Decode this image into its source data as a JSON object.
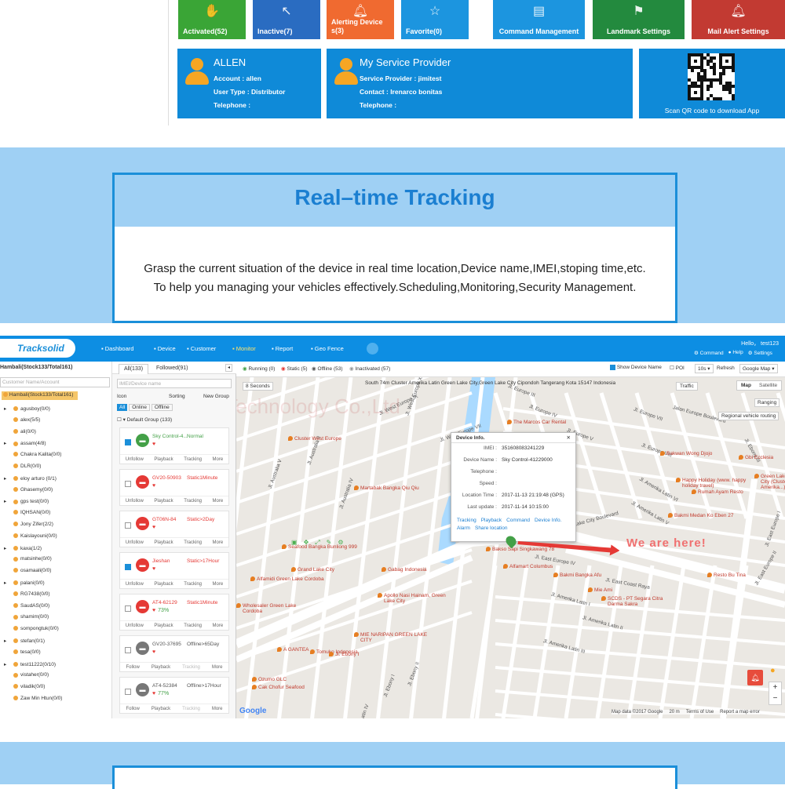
{
  "tiles": [
    {
      "label": "Activated(52)",
      "icon": "star-hand-icon",
      "color": "#3aa536"
    },
    {
      "label": "Inactive(7)",
      "icon": "cursor-click-icon",
      "color": "#2a6cc1"
    },
    {
      "label": "Alerting Device s(3)",
      "icon": "bell-icon",
      "color": "#f06a30"
    },
    {
      "label": "Favorite(0)",
      "icon": "star-icon",
      "color": "#1c95df"
    },
    {
      "label": "Command Management",
      "icon": "notebook-icon",
      "color": "#1c95df"
    },
    {
      "label": "Landmark Settings",
      "icon": "flag-icon",
      "color": "#238a3e"
    },
    {
      "label": "Mail Alert Settings",
      "icon": "bell-gear-icon",
      "color": "#c23a32"
    }
  ],
  "account_card": {
    "name": "ALLEN",
    "account": "Account : allen",
    "user_type": "User Type : Distributor",
    "telephone": "Telephone :"
  },
  "provider_card": {
    "name": "My Service Provider",
    "provider": "Service Provider : jimitest",
    "contact": "Contact : Irenarco bonitas",
    "telephone": "Telephone :"
  },
  "qr_card": {
    "caption": "Scan QR code to download App"
  },
  "banner": {
    "title": "Real–time Tracking",
    "line1": "Grasp the current situation of the device in real time location,Device name,IMEI,stoping time,etc.",
    "line2": "To help you managing your vehicles effectively.Scheduling,Monitoring,Security Management."
  },
  "app": {
    "logo": "Tracksolid",
    "nav": [
      "Dashboard",
      "Device",
      "Customer",
      "Monitor",
      "Report",
      "Geo Fence"
    ],
    "user": "Hello， test123",
    "cmd": "Command",
    "help": "Help",
    "settings": "Settings",
    "tree_title": "Hambali(Stock133/Total161)",
    "customer_placeholder": "Customer Name/Account",
    "tree_head": "Hambali(Stock133/Total161)",
    "tree": [
      "agusboy(0/0)",
      "alex(5/5)",
      "ali(0/0)",
      "assam(4/8)",
      "Chakra Kalita(0/0)",
      "DLR(0/0)",
      "eloy arturo (0/1)",
      "Ghasemy(0/0)",
      "gps test(0/0)",
      "IQHSAN(0/0)",
      "Jony Zifer(2/2)",
      "Kaislayouni(0/0)",
      "kaxa(1/2)",
      "matsinhe(0/0)",
      "osamaali(0/0)",
      "palani(0/0)",
      "RG7438(0/0)",
      "SaudAS(0/0)",
      "shamim(0/0)",
      "sompongtuk(0/0)",
      "stefan(0/1)",
      "tesa(0/0)",
      "test11222(0/10)",
      "vistaher(0/0)",
      "viladik(0/0)",
      "Zaw Min Htun(0/0)"
    ],
    "tab_all": "All(133)",
    "tab_followed": "Followed(91)",
    "imei_placeholder": "IMEI/Device name",
    "icon_label": "Icon",
    "sorting": "Sorting",
    "new_group": "New Group",
    "filter_all": "All",
    "filter_online": "Online",
    "filter_offline": "Offline",
    "default_group": "Default Group (133)",
    "devices": [
      {
        "name": "Sky Control-4...",
        "status": "Normal",
        "kind": "ok",
        "checked": true,
        "acts": [
          "Unfollow",
          "Playback",
          "Tracking",
          "More"
        ]
      },
      {
        "name": "GV20-50903",
        "status": "Static1Minute",
        "kind": "red",
        "checked": false,
        "acts": [
          "Unfollow",
          "Playback",
          "Tracking",
          "More"
        ]
      },
      {
        "name": "GT06N-84",
        "status": "Static>2Day",
        "kind": "red",
        "checked": false,
        "acts": [
          "Unfollow",
          "Playback",
          "Tracking",
          "More"
        ]
      },
      {
        "name": "Jieshan",
        "status": "Static>17Hour",
        "kind": "red",
        "checked": true,
        "acts": [
          "Unfollow",
          "Playback",
          "Tracking",
          "More"
        ]
      },
      {
        "name": "AT4-62129",
        "status": "Static1Minute",
        "kind": "red",
        "checked": false,
        "battery": "73%",
        "acts": [
          "Unfollow",
          "Playback",
          "Tracking",
          "More"
        ]
      },
      {
        "name": "GV20-37695",
        "status": "Offline>65Day",
        "kind": "gray",
        "checked": false,
        "acts": [
          "Follow",
          "Playback",
          "Tracking",
          "More"
        ]
      },
      {
        "name": "AT4-52384",
        "status": "Offline>17Hour",
        "kind": "gray",
        "checked": false,
        "battery": "77%",
        "acts": [
          "Follow",
          "Playback",
          "Tracking",
          "More"
        ]
      }
    ],
    "status_running": "Running (0)",
    "status_static": "Static (5)",
    "status_offline": "Offline (53)",
    "status_inactivated": "Inactivated (57)",
    "show_device_name": "Show Device Name",
    "poi": "POI",
    "refresh_interval": "10s",
    "refresh": "Refresh",
    "map_type": "Google Map",
    "address": "South 74m Cluster Amerika Latin Green Lake City,Green Lake City Cipondoh Tangerang Kota 15147 Indonesia",
    "seconds": "8 Seconds",
    "traffic": "Traffic",
    "map_btn": "Map",
    "satellite_btn": "Satellite",
    "ranging": "Ranging",
    "regional": "Regional vehicle routing",
    "watermark": "Shenzhen Insituit Technology Co.,Ltd",
    "we_are_here": "We are here!",
    "info": {
      "title": "Device Info.",
      "imei_k": "IMEI :",
      "imei_v": "351608083241229",
      "name_k": "Device Name :",
      "name_v": "Sky Control-41229000",
      "tel_k": "Telephone :",
      "speed_k": "Speed :",
      "loc_k": "Location Time :",
      "loc_v": "2017-11-13 21:19:48 (GPS)",
      "upd_k": "Last update :",
      "upd_v": "2017-11-14 10:15:00",
      "links1": [
        "Tracking",
        "Playback",
        "Command",
        "Device Info."
      ],
      "links2": [
        "Alarm",
        "Share location"
      ]
    },
    "map_labels": {
      "streets": [
        "Jl. West Europe IX",
        "Jl. West Europe XI",
        "Jl. West Europe VII",
        "Jl. Australia II",
        "Jl. Australia V",
        "Jl. Australia IV",
        "Jl. Europe III",
        "Jl. Europe IV",
        "Jl. Europe V",
        "Jl. Europe VII",
        "Jl. Europe VIII",
        "Jalan Europe Boulevard",
        "Green Lake City Boulevard",
        "Jl. Amerika Latin I",
        "Jl. Amerika Latin II",
        "Jl. Amerika Latin III",
        "Jl. Amerika Latin IV",
        "Jl. Ebony I",
        "Jl. Ebony II",
        "Jl. Ebony III",
        "Jl. East Europe I",
        "Jl. East Europe II",
        "Jl. East Europe IV",
        "Jl. East Coast Raya",
        "Jl. Amerika Latin V",
        "Jl. Amerika Latin VI"
      ],
      "places": [
        "Cluster West Europe",
        "The Marcos Car Rental",
        "Martabak Bangka Qiu Qiu",
        "Bakwan Wong Djojo",
        "Gbi Ecclesia",
        "Seafood Bangka Bunliong 999",
        "Grand Lake City",
        "Alfamidi Green Lake Cordoba",
        "Gabag Indonesia",
        "Apollo Nasi Hainam, Green Lake City",
        "MIE NARIPAN GREEN LAKE CITY",
        "Tomuko Indonesia",
        "A GANTEA",
        "Ozumo GLC",
        "Cak Chofur Seafood",
        "Bakso Sapi Singkawang 78",
        "Alfamart Columbus",
        "Bakmi Bangka Afu",
        "Mie Ami",
        "SCDS - PT Segara Citra Darma Sakra",
        "Happy Holiday (www. happy holiday travel)",
        "Rumah Ayam Resto",
        "Bakmi Medan Ko Eben 27",
        "Resto Bu Tina",
        "Green Lake City (Cluster Amerika...)",
        "Wholesaler Green Lake Cordoba",
        "Jl. Ebony I"
      ],
      "attribution": "Map data ©2017 Google",
      "scale": "20 m",
      "terms": "Terms of Use",
      "report": "Report a map error",
      "google": "Google"
    }
  }
}
